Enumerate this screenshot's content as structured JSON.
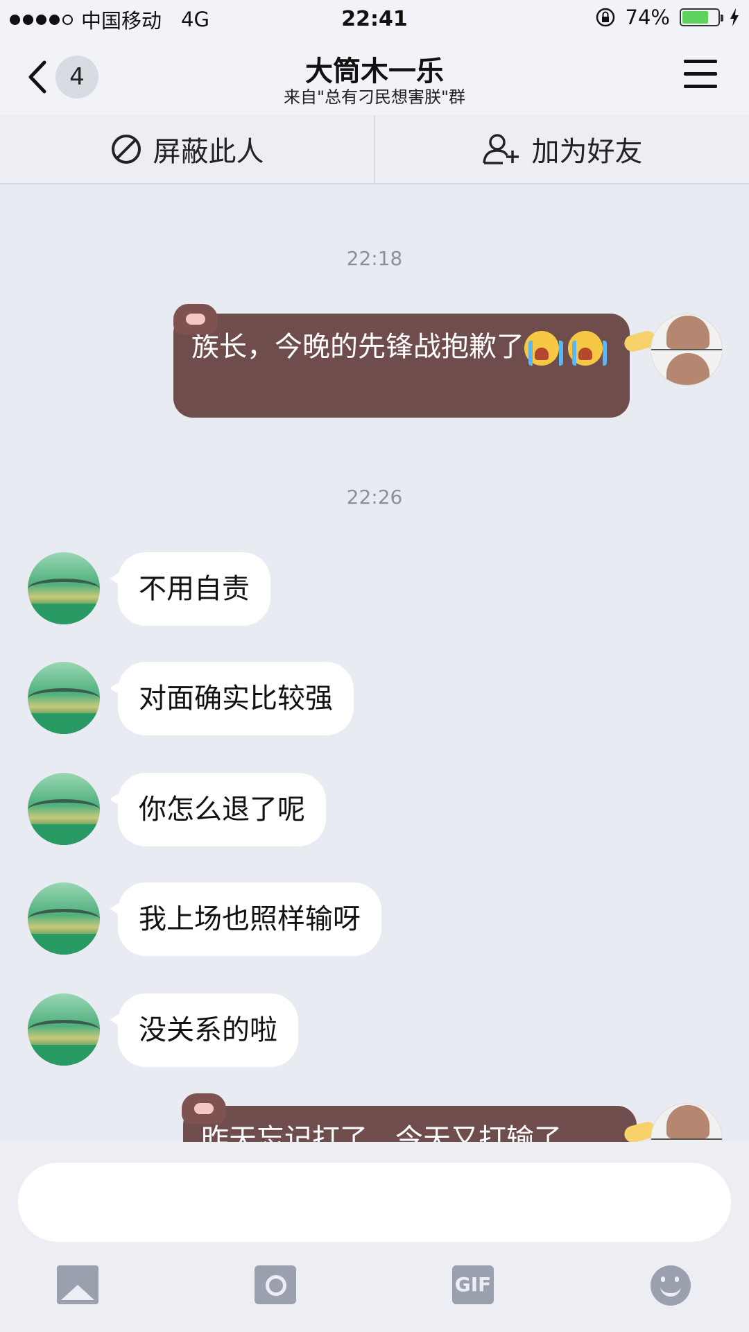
{
  "status_bar": {
    "carrier": "中国移动",
    "network": "4G",
    "time": "22:41",
    "battery": "74%",
    "battery_level": 0.74
  },
  "nav": {
    "back_count": "4",
    "title": "大筒木一乐",
    "subtitle": "来自\"总有刁民想害朕\"群"
  },
  "actions": {
    "block_label": "屏蔽此人",
    "add_friend_label": "加为好友"
  },
  "messages": {
    "time_1": "22:18",
    "out_1": "族长，今晚的先锋战抱歉了",
    "time_2": "22:26",
    "in_1": "不用自责",
    "in_2": "对面确实比较强",
    "in_3": "你怎么退了呢",
    "in_4": "我上场也照样输呀",
    "in_5": "没关系的啦",
    "out_2": "昨天忘记打了，今天又打输了"
  },
  "input": {
    "placeholder": ""
  },
  "toolbar": {
    "gif_label": "GIF"
  },
  "colors": {
    "outgoing_bubble": "#6f4d4c",
    "incoming_bubble": "#ffffff",
    "background": "#e9ebf2"
  }
}
